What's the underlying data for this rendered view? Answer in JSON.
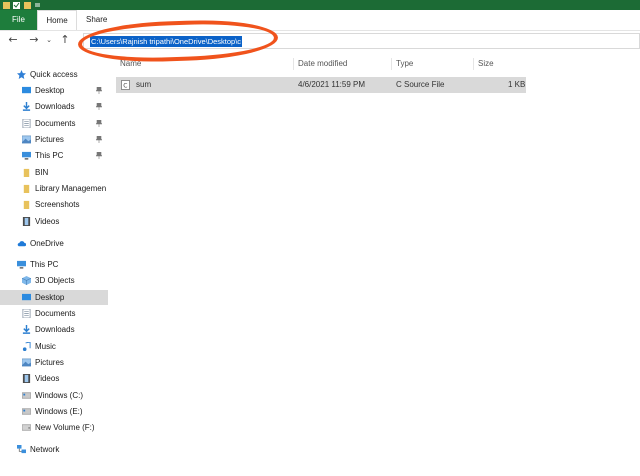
{
  "ribbon": {
    "tabs": [
      "File",
      "Home",
      "Share"
    ]
  },
  "address": {
    "path": "C:\\Users\\Rajnish tripathi\\OneDrive\\Desktop\\c"
  },
  "columns": [
    "Name",
    "Date modified",
    "Type",
    "Size"
  ],
  "files": [
    {
      "name": "sum",
      "date": "4/6/2021 11:59 PM",
      "type": "C Source File",
      "size": "1 KB"
    }
  ],
  "nav": {
    "quick_access": "Quick access",
    "quick_items": [
      "Desktop",
      "Downloads",
      "Documents",
      "Pictures",
      "This PC",
      "BIN",
      "Library Managemen",
      "Screenshots",
      "Videos"
    ],
    "onedrive": "OneDrive",
    "this_pc": "This PC",
    "pc_items": [
      "3D Objects",
      "Desktop",
      "Documents",
      "Downloads",
      "Music",
      "Pictures",
      "Videos",
      "Windows (C:)",
      "Windows (E:)",
      "New Volume (F:)"
    ],
    "network": "Network"
  },
  "colors": {
    "title_green": "#1c6b35",
    "file_tab": "#1e7d3c",
    "selection_blue": "#0b62c8",
    "annotation_orange": "#f0531c",
    "row_highlight": "#d9d9d9"
  }
}
